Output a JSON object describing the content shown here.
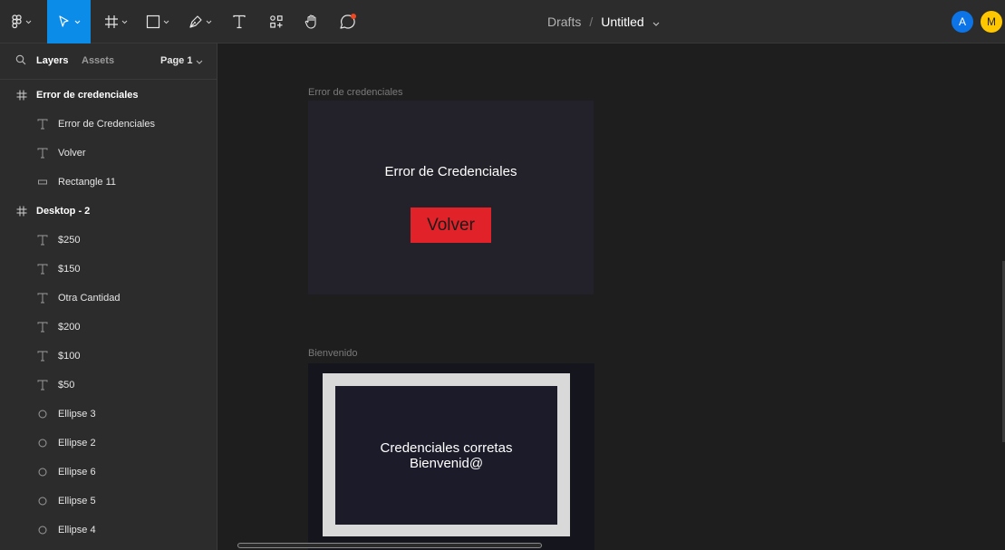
{
  "toolbar": {
    "breadcrumb": "Drafts",
    "separator": "/",
    "file_title": "Untitled",
    "tools": [
      "main-menu",
      "move",
      "frame",
      "shape",
      "pen",
      "text",
      "resources",
      "hand",
      "comment"
    ],
    "active_tool": "move",
    "colors": {
      "active": "#0c8ce9",
      "notification": "#f24822"
    }
  },
  "avatars": [
    {
      "initial": "A",
      "color": "#0d74e7"
    },
    {
      "initial": "M",
      "color": "#ffc700"
    }
  ],
  "sidebar": {
    "tabs": {
      "layers": "Layers",
      "assets": "Assets",
      "page": "Page 1"
    },
    "layers": [
      {
        "label": "Error de credenciales",
        "icon": "frame-icon",
        "level": 0
      },
      {
        "label": "Error de Credenciales",
        "icon": "text-icon",
        "level": 1
      },
      {
        "label": "Volver",
        "icon": "text-icon",
        "level": 1
      },
      {
        "label": "Rectangle 11",
        "icon": "rectangle-icon",
        "level": 1
      },
      {
        "label": "Desktop - 2",
        "icon": "frame-icon",
        "level": 0
      },
      {
        "label": "$250",
        "icon": "text-icon",
        "level": 1
      },
      {
        "label": "$150",
        "icon": "text-icon",
        "level": 1
      },
      {
        "label": "Otra Cantidad",
        "icon": "text-icon",
        "level": 1
      },
      {
        "label": "$200",
        "icon": "text-icon",
        "level": 1
      },
      {
        "label": "$100",
        "icon": "text-icon",
        "level": 1
      },
      {
        "label": "$50",
        "icon": "text-icon",
        "level": 1
      },
      {
        "label": "Ellipse 3",
        "icon": "ellipse-icon",
        "level": 1
      },
      {
        "label": "Ellipse 2",
        "icon": "ellipse-icon",
        "level": 1
      },
      {
        "label": "Ellipse 6",
        "icon": "ellipse-icon",
        "level": 1
      },
      {
        "label": "Ellipse 5",
        "icon": "ellipse-icon",
        "level": 1
      },
      {
        "label": "Ellipse 4",
        "icon": "ellipse-icon",
        "level": 1
      }
    ]
  },
  "canvas": {
    "frame1": {
      "label": "Error de credenciales",
      "heading": "Error de Credenciales",
      "button": "Volver",
      "button_color": "#e22229"
    },
    "frame2": {
      "label": "Bienvenido",
      "line1": "Credenciales corretas",
      "line2": "Bienvenid@"
    }
  }
}
